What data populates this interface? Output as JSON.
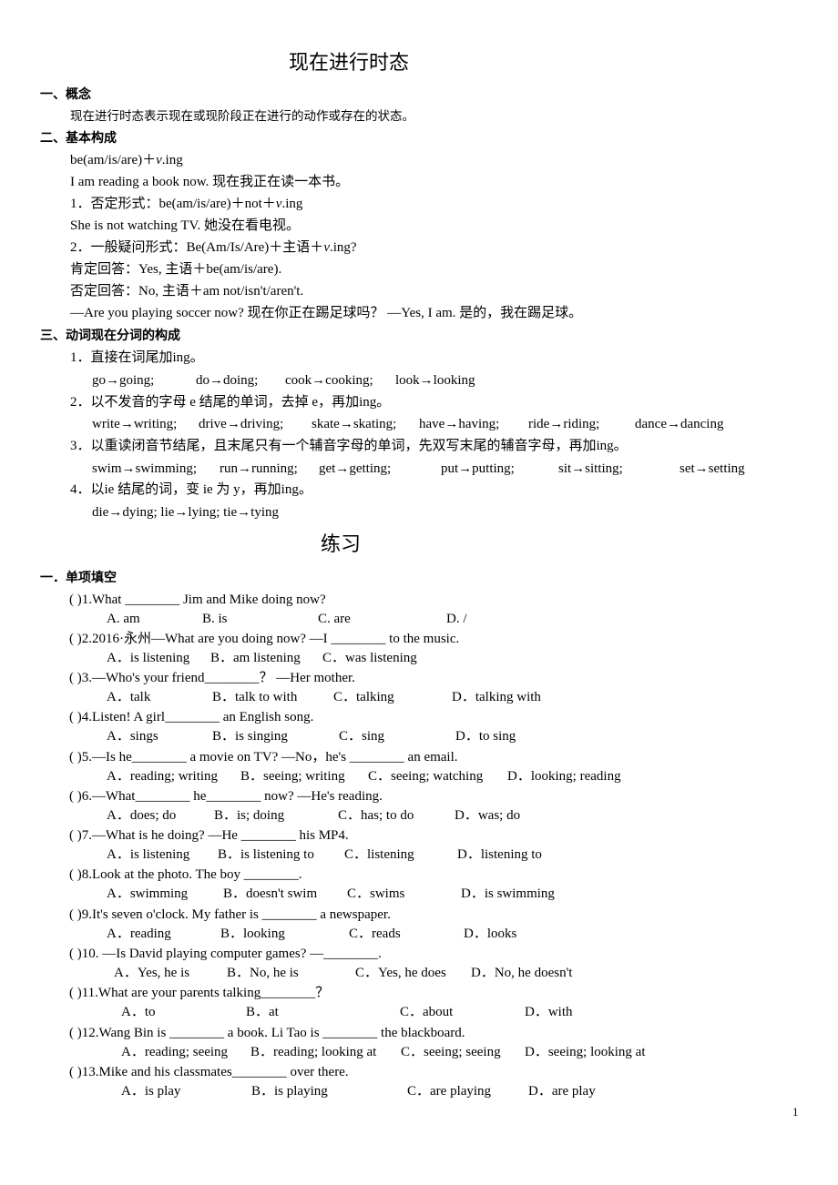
{
  "title": "现在进行时态",
  "sections": {
    "concept": {
      "heading": "一、概念",
      "text": "现在进行时态表示现在或现阶段正在进行的动作或存在的状态。"
    },
    "structure": {
      "heading": "二、基本构成",
      "formula_prefix": "be(am/is/are)＋",
      "formula_v": "v",
      "formula_suffix": ".ing",
      "example1": "I am reading a book now.  现在我正在读一本书。",
      "negative_label": "1．否定形式：be(am/is/are)＋not＋",
      "negative_v": "v",
      "negative_suffix": ".ing",
      "negative_example": "She is not watching TV.  她没在看电视。",
      "question_label": "2．一般疑问形式：Be(Am/Is/Are)＋主语＋",
      "question_v": "v",
      "question_suffix": ".ing?",
      "affirmative_answer": "肯定回答：Yes,  主语＋be(am/is/are).",
      "negative_answer": "否定回答：No,  主语＋am not/isn't/aren't.",
      "dialogue": "—Are you playing soccer now?  现在你正在踢足球吗？   —Yes, I am.  是的，我在踢足球。"
    },
    "participle": {
      "heading": "三、动词现在分词的构成",
      "rules": [
        {
          "label": "1．直接在词尾加ing。",
          "examples": [
            "go→going;",
            "do→doing;",
            "cook→cooking;",
            "look→looking"
          ]
        },
        {
          "label": "2．以不发音的字母 e 结尾的单词，去掉 e，再加ing。",
          "examples": [
            "write→writing;",
            "drive→driving;",
            "skate→skating;",
            "have→having;",
            "ride→riding;",
            "dance→dancing"
          ]
        },
        {
          "label": "3．以重读闭音节结尾，且末尾只有一个辅音字母的单词，先双写末尾的辅音字母，再加ing。",
          "examples": [
            "swim→swimming;",
            "run→running;",
            "get→getting;",
            "put→putting;",
            "sit→sitting;",
            "set→setting"
          ]
        },
        {
          "label": "4．以ie 结尾的词，变 ie 为 y，再加ing。",
          "examples": [
            "die→dying; lie→lying; tie→tying"
          ]
        }
      ]
    }
  },
  "practice": {
    "title": "练习",
    "section_heading": "一．单项填空",
    "questions": [
      {
        "stem": "(    )1.What ________ Jim and Mike doing now?",
        "options": [
          "A. am",
          "B. is",
          "C. are",
          "D. /"
        ]
      },
      {
        "stem": "(    )2.2016·永州—What are you doing now? —I ________ to the music.",
        "options": [
          "A．is listening",
          "B．am listening",
          "C．was listening"
        ]
      },
      {
        "stem": "(    )3.—Who's your friend________？   —Her mother.",
        "options": [
          "A．talk",
          "B．talk to with",
          "C．talking",
          "D．talking with"
        ]
      },
      {
        "stem": "(    )4.Listen! A girl________ an English song.",
        "options": [
          "A．sings",
          "B．is singing",
          "C．sing",
          "D．to sing"
        ]
      },
      {
        "stem": "(    )5.—Is he________ a movie on TV?   —No，he's ________ an email.",
        "options": [
          "A．reading; writing",
          "B．seeing; writing",
          "C．seeing; watching",
          "D．looking; reading"
        ]
      },
      {
        "stem": "(    )6.—What________ he________ now?   —He's reading.",
        "options": [
          "A．does;   do",
          "B．is;   doing",
          "C．has;   to do",
          "D．was;   do"
        ]
      },
      {
        "stem": "(    )7.—What is he doing? —He ________ his MP4.",
        "options": [
          "A．is listening",
          "B．is listening to",
          "C．listening",
          "D．listening to"
        ]
      },
      {
        "stem": "(    )8.Look at the photo.   The boy ________.",
        "options": [
          "A．swimming",
          "B．doesn't swim",
          "C．swims",
          "D．is swimming"
        ]
      },
      {
        "stem": "(    )9.It's seven o'clock.   My father is ________ a newspaper.",
        "options": [
          "A．reading",
          "B．looking",
          "C．reads",
          "D．looks"
        ]
      },
      {
        "stem": "(    )10. —Is David playing computer games? —________.",
        "options": [
          "A．Yes, he is",
          "B．No, he is",
          "C．Yes, he does",
          "D．No, he doesn't"
        ]
      },
      {
        "stem": "(    )11.What are your parents talking________？",
        "options": [
          "A．to",
          "B．at",
          "C．about",
          "D．with"
        ]
      },
      {
        "stem": "(    )12.Wang Bin is ________ a book. Li Tao is ________ the blackboard.",
        "options": [
          "A．reading; seeing",
          "B．reading; looking at",
          "C．seeing; seeing",
          "D．seeing; looking at"
        ]
      },
      {
        "stem": "(    )13.Mike and his classmates________ over there.",
        "options": [
          "A．is play",
          "B．is playing",
          "C．are playing",
          "D．are play"
        ]
      }
    ]
  },
  "page_number": "1"
}
